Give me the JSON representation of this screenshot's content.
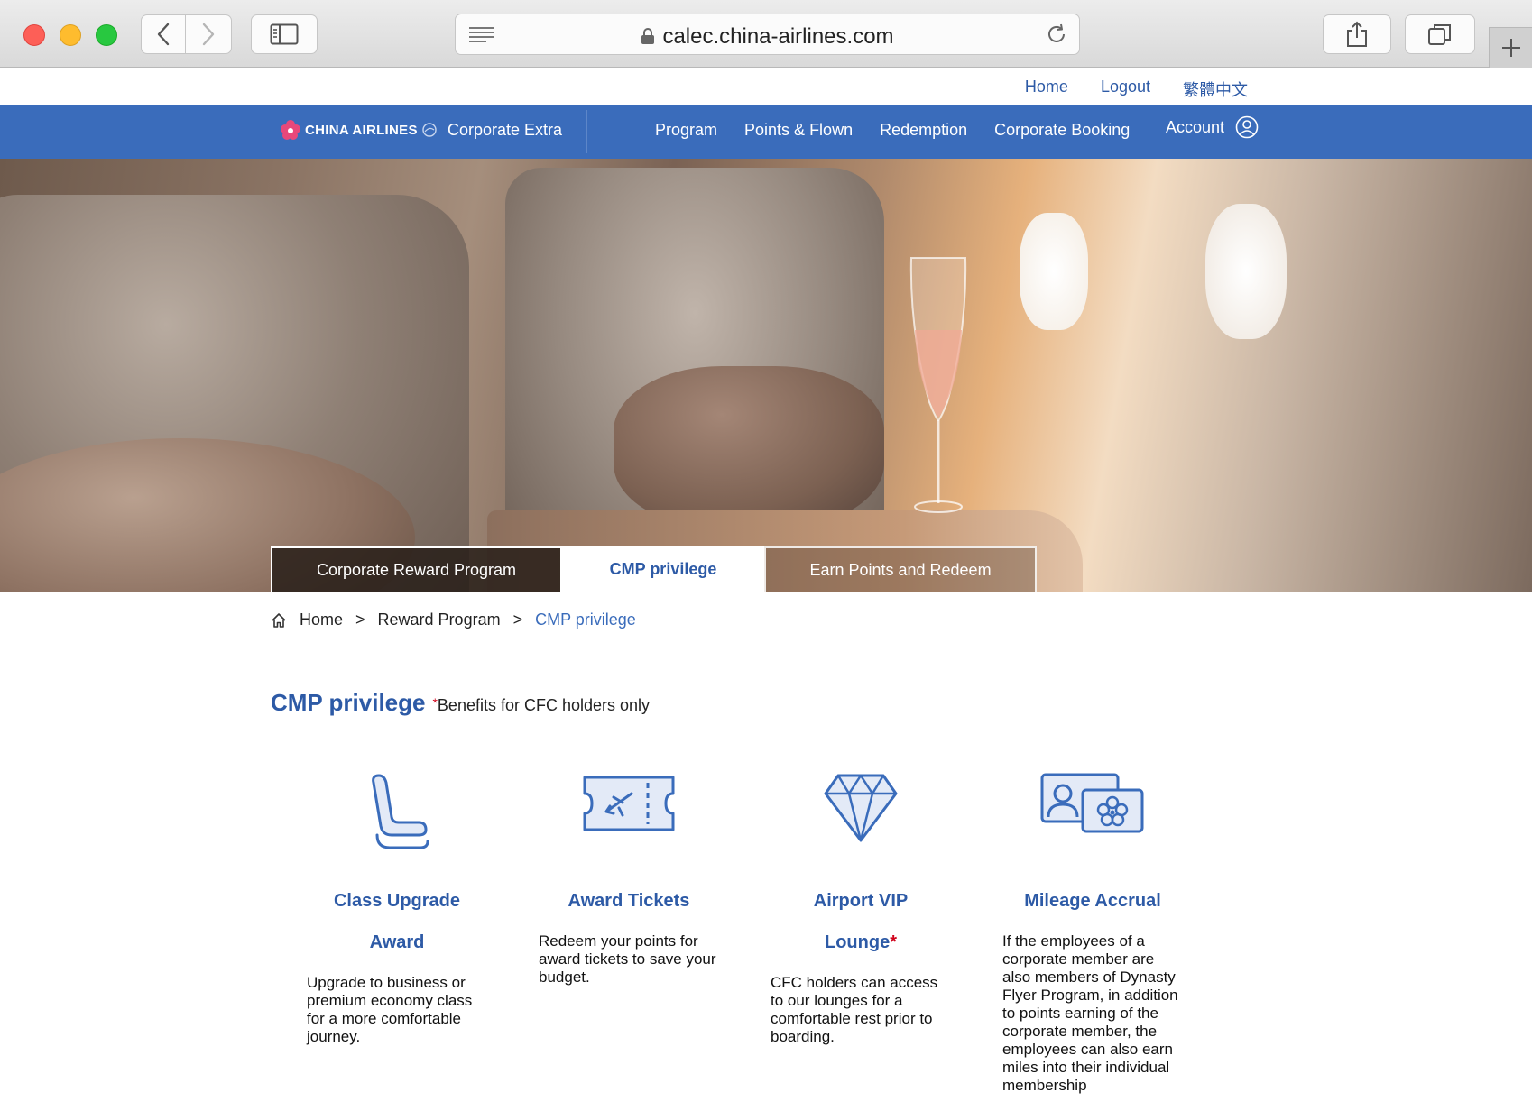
{
  "browser": {
    "url": "calec.china-airlines.com"
  },
  "top_links": [
    "Home",
    "Logout",
    "繁體中文"
  ],
  "navbar": {
    "brand_text": "CHINA AIRLINES",
    "program_name": "Corporate Extra",
    "items": [
      "Program",
      "Points & Flown",
      "Redemption",
      "Corporate Booking"
    ],
    "account_label": "Account"
  },
  "hero_tabs": [
    "Corporate Reward Program",
    "CMP privilege",
    "Earn Points and Redeem"
  ],
  "breadcrumb": {
    "items": [
      "Home",
      "Reward Program",
      "CMP privilege"
    ],
    "separator": ">"
  },
  "section": {
    "title": "CMP privilege",
    "note_asterisk": "*",
    "note": "Benefits for CFC holders only"
  },
  "cards": [
    {
      "icon": "seat-icon",
      "title_line1": "Class Upgrade",
      "title_line2": "Award",
      "description": "Upgrade to business or premium economy class for a more comfortable journey."
    },
    {
      "icon": "ticket-icon",
      "title_line1": "Award Tickets",
      "title_line2": "",
      "description": "Redeem your points for award tickets to save your budget."
    },
    {
      "icon": "diamond-icon",
      "title_line1": "Airport VIP",
      "title_line2": "Lounge",
      "title_asterisk": "*",
      "description": "CFC holders can access to our lounges for a comfortable rest prior to boarding."
    },
    {
      "icon": "membership-card-icon",
      "title_line1": "Mileage Accrual",
      "title_line2": "",
      "description": "If the employees of a corporate member are also members of Dynasty Flyer Program, in addition to points earning of the corporate member, the employees can also earn miles into their individual membership"
    }
  ],
  "colors": {
    "brand_blue": "#3a6cbb",
    "link_blue": "#2d5aa6",
    "asterisk_red": "#d0021b"
  }
}
